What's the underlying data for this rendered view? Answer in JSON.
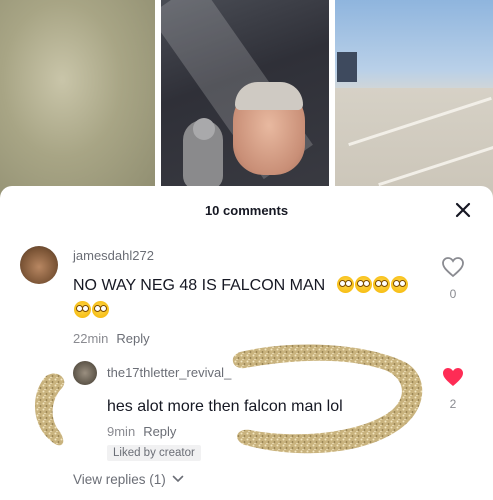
{
  "sheet": {
    "comments_count": "10 comments"
  },
  "icons": {
    "close": "close-icon",
    "like_empty": "heart-outline-icon",
    "like_filled": "heart-filled-icon",
    "chevron": "chevron-down-icon"
  },
  "colors": {
    "liked_heart": "#fe2c55",
    "text_primary": "#161823",
    "text_secondary": "#8a8b91"
  },
  "comments": [
    {
      "username": "jamesdahl272",
      "text": "NO WAY NEG 48 IS FALCON MAN",
      "time": "22min",
      "reply_label": "Reply",
      "likes": "0",
      "liked": false
    },
    {
      "username": "the17thletter_revival_",
      "text": "hes alot more then falcon man lol",
      "time": "9min",
      "reply_label": "Reply",
      "likes": "2",
      "liked": true,
      "badge": "Liked by creator"
    }
  ],
  "view_replies": "View replies (1)"
}
